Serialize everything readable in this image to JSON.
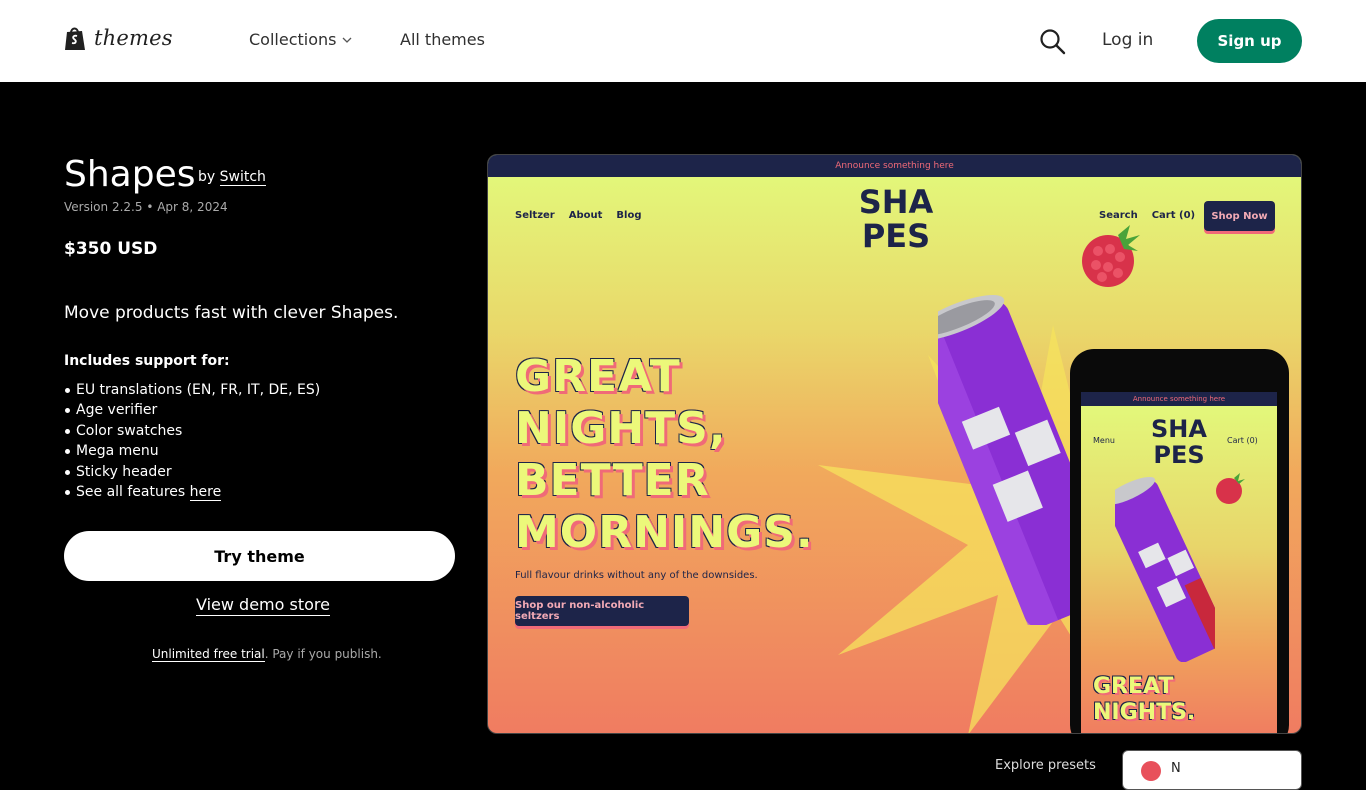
{
  "header": {
    "logo_text": "themes",
    "nav": {
      "collections": "Collections",
      "all_themes": "All themes"
    },
    "login": "Log in",
    "signup": "Sign up"
  },
  "theme": {
    "name": "Shapes",
    "by_prefix": "by",
    "author": "Switch",
    "version": "Version 2.2.5",
    "date": "Apr 8, 2024",
    "price": "$350 USD",
    "tagline": "Move products fast with clever Shapes.",
    "includes_label": "Includes support for:",
    "features": [
      "EU translations (EN, FR, IT, DE, ES)",
      "Age verifier",
      "Color swatches",
      "Mega menu",
      "Sticky header"
    ],
    "see_all_prefix": "See all features",
    "see_all_link": "here",
    "try_theme": "Try theme",
    "view_demo": "View demo store",
    "trial_link": "Unlimited free trial",
    "trial_rest": ". Pay if you publish."
  },
  "preview": {
    "announce": "Announce something here",
    "nav_left": [
      "Seltzer",
      "About",
      "Blog"
    ],
    "nav_right": [
      "Search",
      "Cart (0)"
    ],
    "shop_now": "Shop Now",
    "logo_text_1": "SHA",
    "logo_text_2": "PES",
    "headline": [
      "GREAT",
      "NIGHTS,",
      "BETTER",
      "MORNINGS."
    ],
    "subline": "Full flavour drinks without any of the downsides.",
    "cta": "Shop our non-alcoholic seltzers",
    "phone": {
      "announce": "Announce something here",
      "menu": "Menu",
      "cart": "Cart (0)",
      "headline": [
        "GREAT",
        "NIGHTS."
      ]
    }
  },
  "explore": {
    "label": "Explore presets",
    "selected": "N"
  },
  "colors": {
    "signup_bg": "#008060",
    "preview_navy": "#1d2449",
    "preview_pink": "#f06a78",
    "preview_yellow": "#ecf87a"
  }
}
